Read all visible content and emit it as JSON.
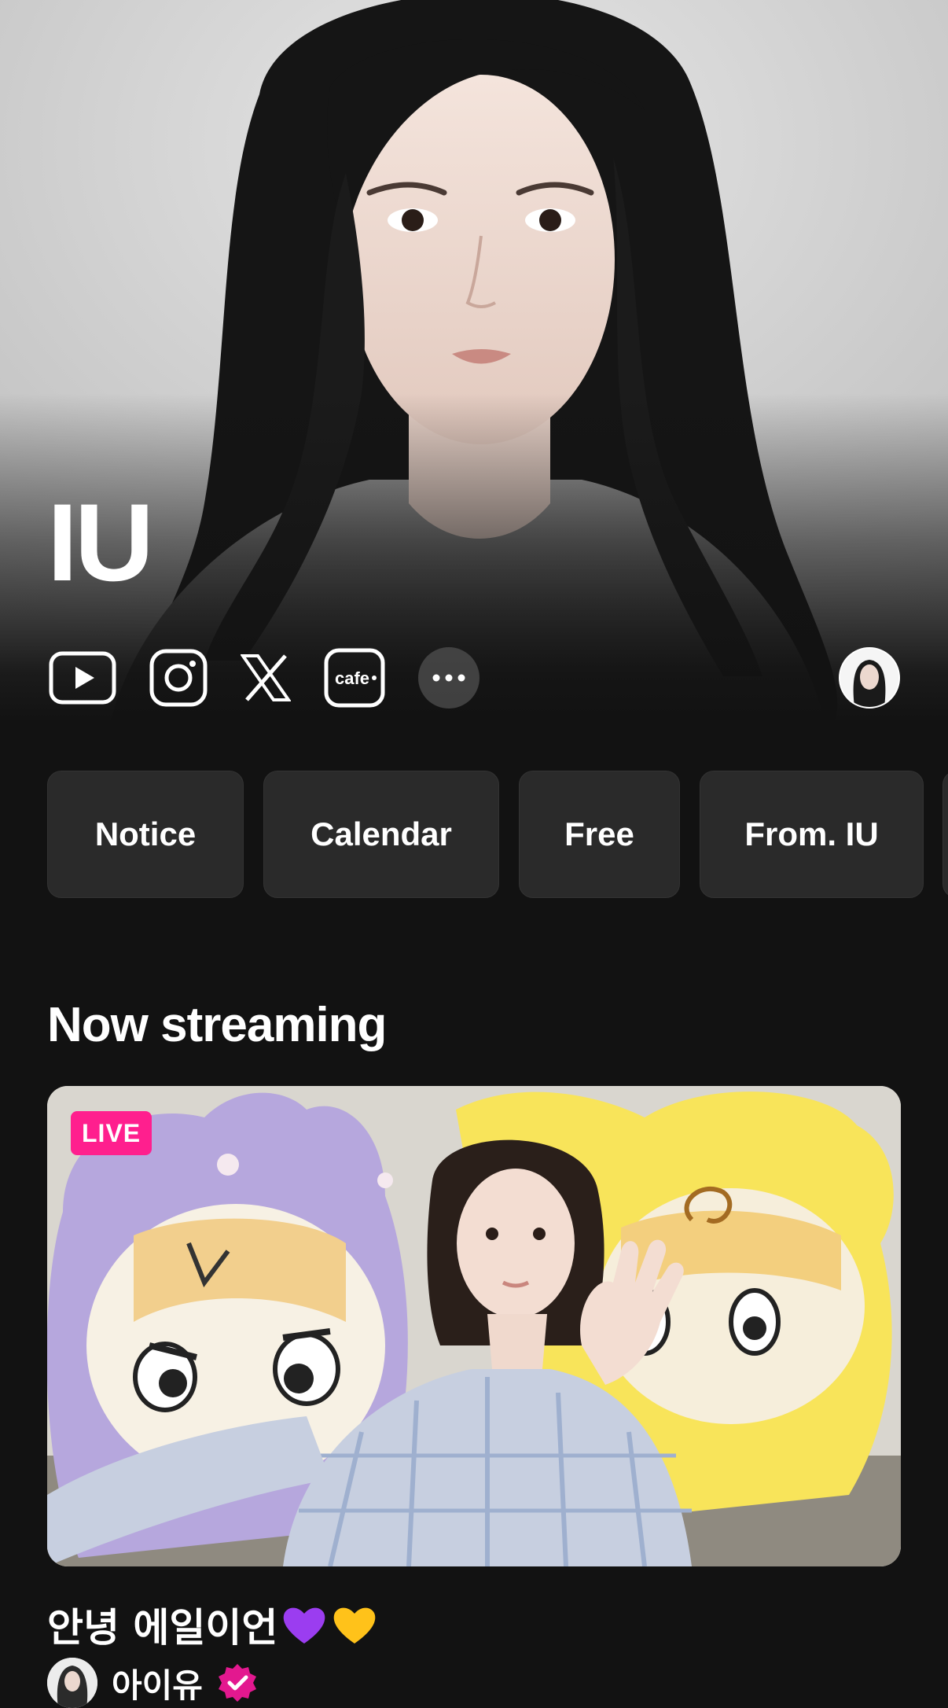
{
  "hero": {
    "artist_name": "IU",
    "social_icons": [
      "youtube-icon",
      "instagram-icon",
      "x-icon",
      "cafe-icon",
      "more-icon"
    ],
    "cafe_label": "cafe"
  },
  "board_tabs": [
    {
      "label": "Notice"
    },
    {
      "label": "Calendar"
    },
    {
      "label": "Free"
    },
    {
      "label": "From. IU"
    }
  ],
  "now_streaming": {
    "section_title": "Now streaming",
    "live_badge": "LIVE",
    "stream_title": "안녕 에일이언",
    "author_name": "아이유",
    "heart_colors": [
      "#9b3df0",
      "#ffc21a"
    ],
    "badge_color": "#ff1f8e",
    "verified_color": "#e3188f"
  }
}
